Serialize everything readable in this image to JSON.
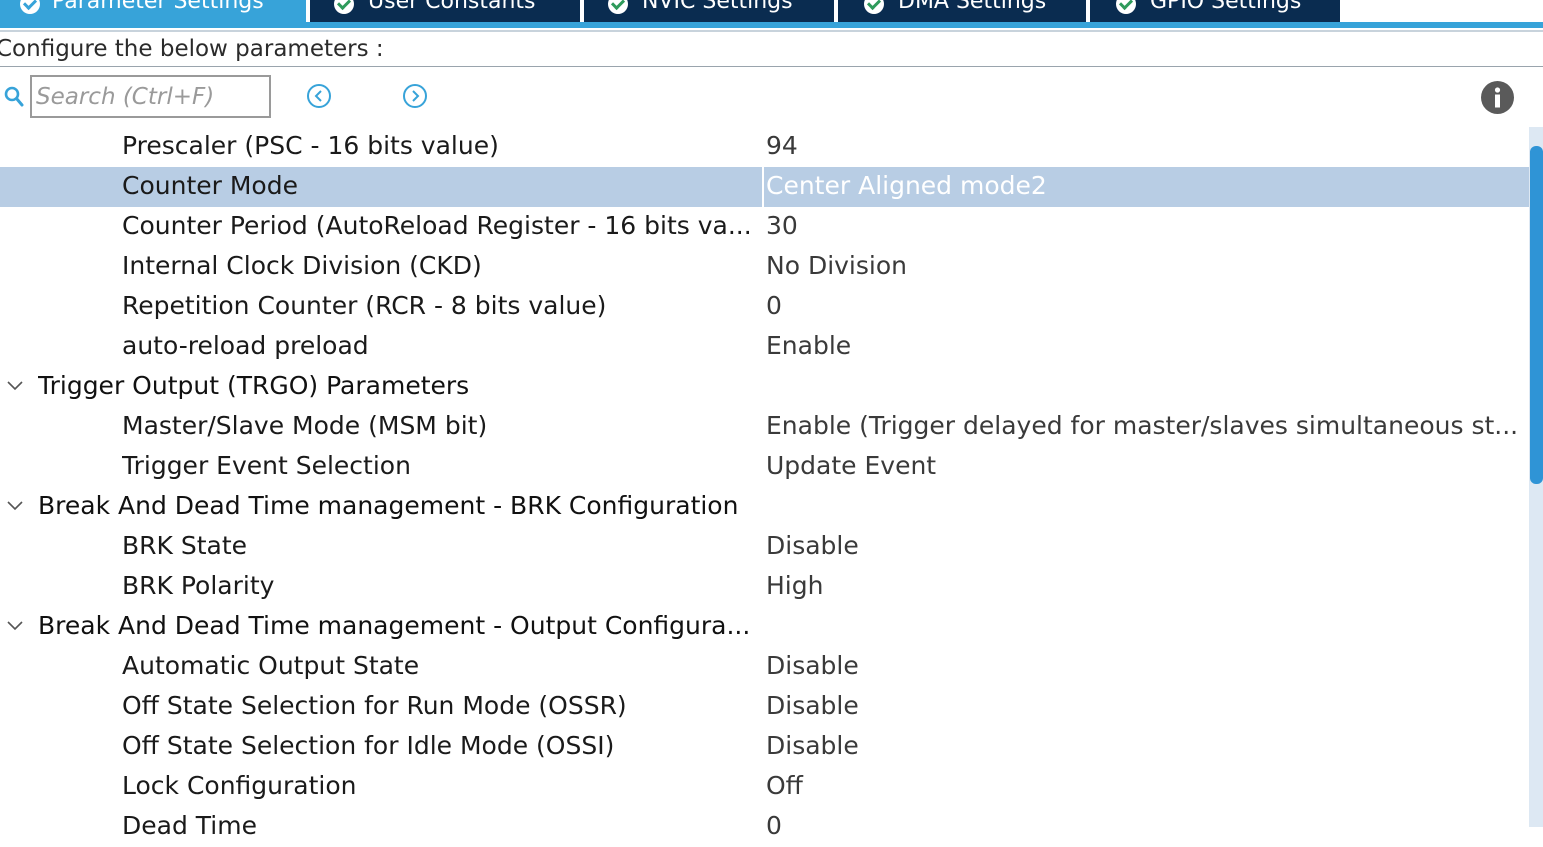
{
  "tabs": [
    {
      "label": "Parameter Settings",
      "active": true
    },
    {
      "label": "User Constants",
      "active": false
    },
    {
      "label": "NVIC Settings",
      "active": false
    },
    {
      "label": "DMA Settings",
      "active": false
    },
    {
      "label": "GPIO Settings",
      "active": false
    }
  ],
  "header": {
    "configure_label": "Configure the below parameters :"
  },
  "search": {
    "placeholder": "Search (Ctrl+F)",
    "value": ""
  },
  "icons": {
    "search": "search-icon",
    "prev": "chevron-left-circle-icon",
    "next": "chevron-right-circle-icon",
    "info": "info-icon",
    "tab_status": "check-circle-icon",
    "group_toggle": "chevron-down-icon"
  },
  "colors": {
    "active_tab": "#37a3d9",
    "inactive_tab": "#0a2c50",
    "selection": "#b8cde4",
    "scroll_thumb": "#2f94d6"
  },
  "rows": [
    {
      "type": "param",
      "name": "Prescaler (PSC - 16 bits value)",
      "value": "94"
    },
    {
      "type": "param",
      "name": "Counter Mode",
      "value": "Center Aligned mode2",
      "selected": true
    },
    {
      "type": "param",
      "name": "Counter Period (AutoReload Register - 16 bits va...",
      "value": "30"
    },
    {
      "type": "param",
      "name": "Internal Clock Division (CKD)",
      "value": "No Division"
    },
    {
      "type": "param",
      "name": "Repetition Counter (RCR - 8 bits value)",
      "value": "0"
    },
    {
      "type": "param",
      "name": "auto-reload preload",
      "value": "Enable"
    },
    {
      "type": "group",
      "name": "Trigger Output (TRGO) Parameters"
    },
    {
      "type": "param",
      "name": "Master/Slave Mode (MSM bit)",
      "value": "Enable (Trigger delayed for master/slaves simultaneous st..."
    },
    {
      "type": "param",
      "name": "Trigger Event Selection",
      "value": "Update Event"
    },
    {
      "type": "group",
      "name": "Break And Dead Time management - BRK Configuration"
    },
    {
      "type": "param",
      "name": "BRK State",
      "value": "Disable"
    },
    {
      "type": "param",
      "name": "BRK Polarity",
      "value": "High"
    },
    {
      "type": "group",
      "name": "Break And Dead Time management - Output Configura..."
    },
    {
      "type": "param",
      "name": "Automatic Output State",
      "value": "Disable"
    },
    {
      "type": "param",
      "name": "Off State Selection for Run Mode (OSSR)",
      "value": "Disable"
    },
    {
      "type": "param",
      "name": "Off State Selection for Idle Mode (OSSI)",
      "value": "Disable"
    },
    {
      "type": "param",
      "name": "Lock Configuration",
      "value": "Off"
    },
    {
      "type": "param",
      "name": "Dead Time",
      "value": "0"
    }
  ]
}
